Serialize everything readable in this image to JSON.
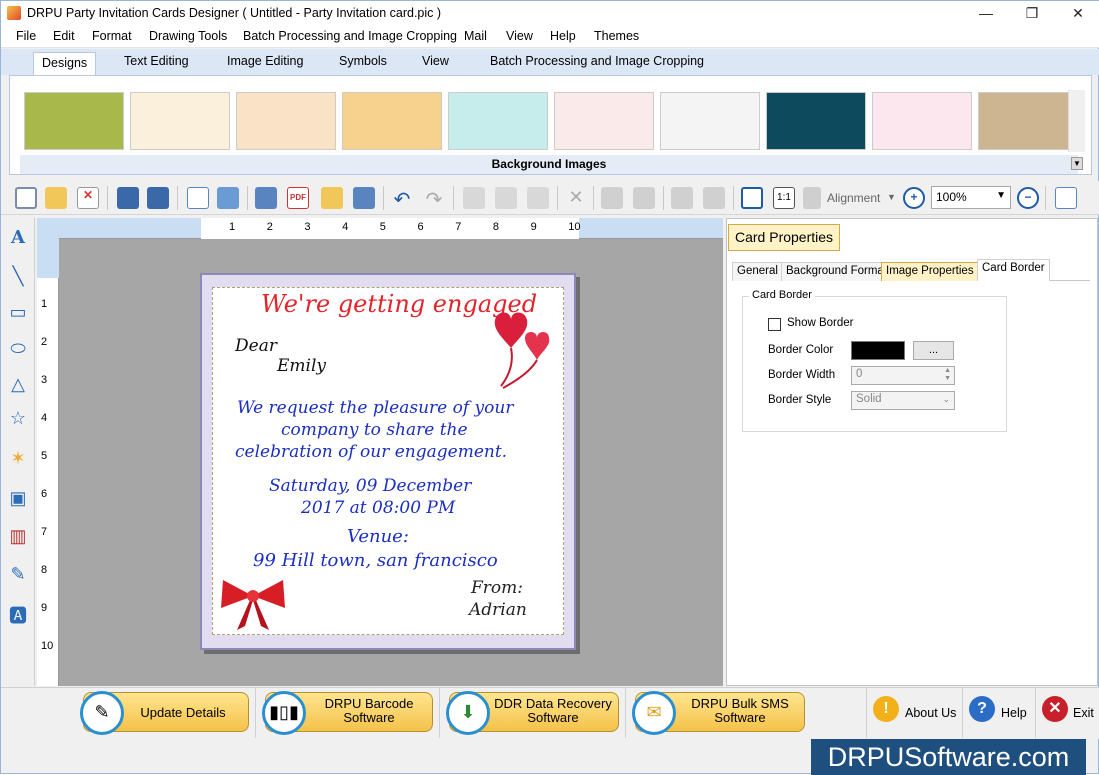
{
  "window": {
    "title": "DRPU Party Invitation Cards Designer ( Untitled - Party Invitation card.pic )",
    "minimize": "—",
    "restore": "❐",
    "close": "✕"
  },
  "menu": [
    "File",
    "Edit",
    "Format",
    "Drawing Tools",
    "Batch Processing and Image Cropping",
    "Mail",
    "View",
    "Help",
    "Themes"
  ],
  "ribbon_tabs": [
    "Designs",
    "Text Editing",
    "Image Editing",
    "Symbols",
    "View",
    "Batch Processing and Image Cropping"
  ],
  "gallery": {
    "label": "Background Images",
    "thumbs": [
      "#a9b84a",
      "#fbf0dc",
      "#f9e2c6",
      "#f6d28e",
      "#c6ecec",
      "#fbeaea",
      "#f4f4f4",
      "#0e4a5e",
      "#fde7ef",
      "#cdb592"
    ]
  },
  "toolbar": {
    "alignment": "Alignment",
    "zoom": "100%"
  },
  "ruler": {
    "h": [
      "1",
      "2",
      "3",
      "4",
      "5",
      "6",
      "7",
      "8",
      "9",
      "10"
    ],
    "v": [
      "1",
      "2",
      "3",
      "4",
      "5",
      "6",
      "7",
      "8",
      "9",
      "10"
    ]
  },
  "card": {
    "heading": "We're getting engaged",
    "dear": "Dear",
    "name": "Emily",
    "line1": "We request the pleasure of your",
    "line2": "company to share the",
    "line3": "celebration of our engagement.",
    "date1": "Saturday, 09 December",
    "date2": "2017 at 08:00 PM",
    "venue_label": "Venue:",
    "venue": "99 Hill town, san francisco",
    "from_label": "From:",
    "from": "Adrian"
  },
  "panel": {
    "title": "Card Properties",
    "tabs": [
      "General",
      "Background Format",
      "Image Properties",
      "Card Border"
    ],
    "group": "Card Border",
    "show_border": "Show Border",
    "border_color": "Border Color",
    "browse": "...",
    "border_width": "Border Width",
    "width_value": "0",
    "border_style": "Border Style",
    "style_value": "Solid"
  },
  "bottom": {
    "update": "Update Details",
    "barcode": "DRPU Barcode Software",
    "ddr": "DDR Data Recovery Software",
    "sms": "DRPU Bulk SMS Software",
    "about": "About Us",
    "help": "Help",
    "exit": "Exit"
  },
  "watermark": "DRPUSoftware.com"
}
